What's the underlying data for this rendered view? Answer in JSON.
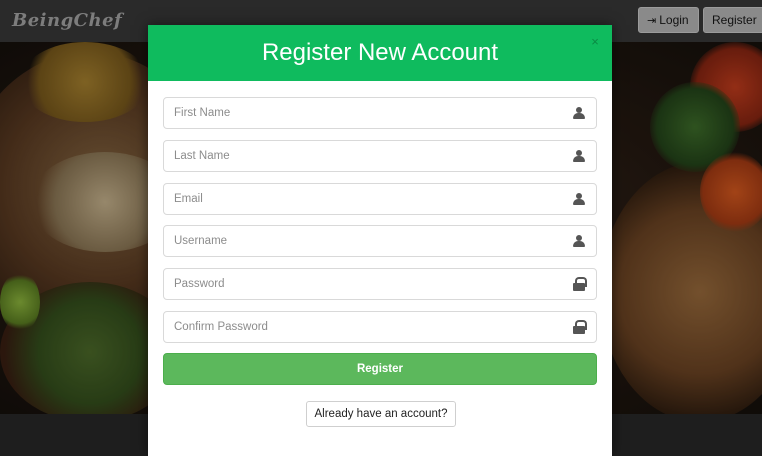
{
  "navbar": {
    "brand": "BeingChef",
    "login_label": "Login",
    "register_label": "Register"
  },
  "modal": {
    "title": "Register New Account",
    "close_symbol": "×",
    "fields": [
      {
        "placeholder": "First Name",
        "value": "",
        "icon": "person-icon"
      },
      {
        "placeholder": "Last Name",
        "value": "",
        "icon": "person-icon"
      },
      {
        "placeholder": "Email",
        "value": "",
        "icon": "person-icon"
      },
      {
        "placeholder": "Username",
        "value": "",
        "icon": "person-icon"
      },
      {
        "placeholder": "Password",
        "value": "",
        "icon": "lock-icon"
      },
      {
        "placeholder": "Confirm Password",
        "value": "",
        "icon": "lock-icon"
      }
    ],
    "register_button": "Register",
    "already_button": "Already have an account?"
  },
  "colors": {
    "modal_header": "#0fbb5e",
    "register_button": "#5cb85c",
    "overlay": "#1c1c1c"
  }
}
